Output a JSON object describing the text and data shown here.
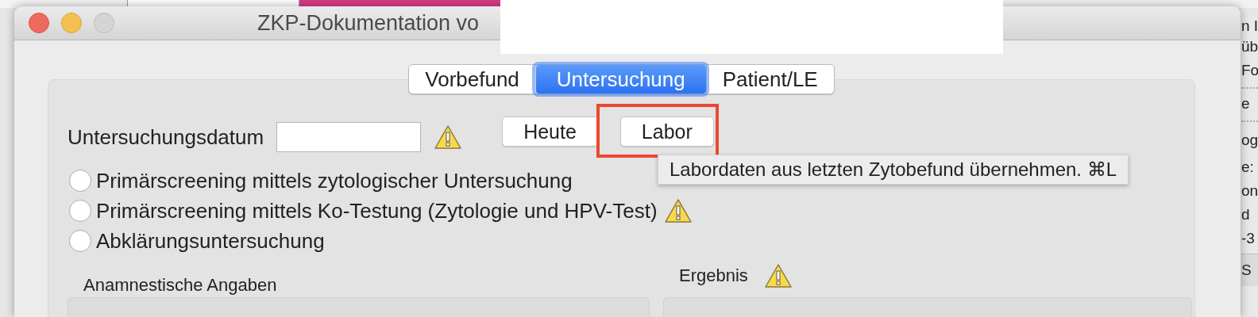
{
  "background_app": {
    "texts": [
      "n I",
      "üb",
      "Fo",
      "e",
      "og",
      "e:",
      "on",
      "d",
      "-3",
      "S"
    ]
  },
  "window": {
    "title": "ZKP-Dokumentation vo"
  },
  "tabs": [
    {
      "label": "Vorbefund",
      "selected": false
    },
    {
      "label": "Untersuchung",
      "selected": true
    },
    {
      "label": "Patient/LE",
      "selected": false
    }
  ],
  "date_field": {
    "label": "Untersuchungsdatum",
    "warning": true
  },
  "buttons": [
    {
      "label": "Heute",
      "highlighted": false
    },
    {
      "label": "Labor",
      "highlighted": true
    }
  ],
  "tooltip": {
    "text": "Labordaten aus letzten Zytobefund übernehmen. ⌘L"
  },
  "screening_options": [
    {
      "label": "Primärscreening mittels zytologischer Untersuchung",
      "selected": false,
      "warning": false
    },
    {
      "label": "Primärscreening mittels Ko-Testung (Zytologie und HPV-Test)",
      "selected": false,
      "warning": true
    },
    {
      "label": "Abklärungsuntersuchung",
      "selected": false,
      "warning": false
    }
  ],
  "sections": [
    {
      "title": "Anamnestische Angaben",
      "warning": false
    },
    {
      "title": "Ergebnis",
      "warning": true
    }
  ]
}
